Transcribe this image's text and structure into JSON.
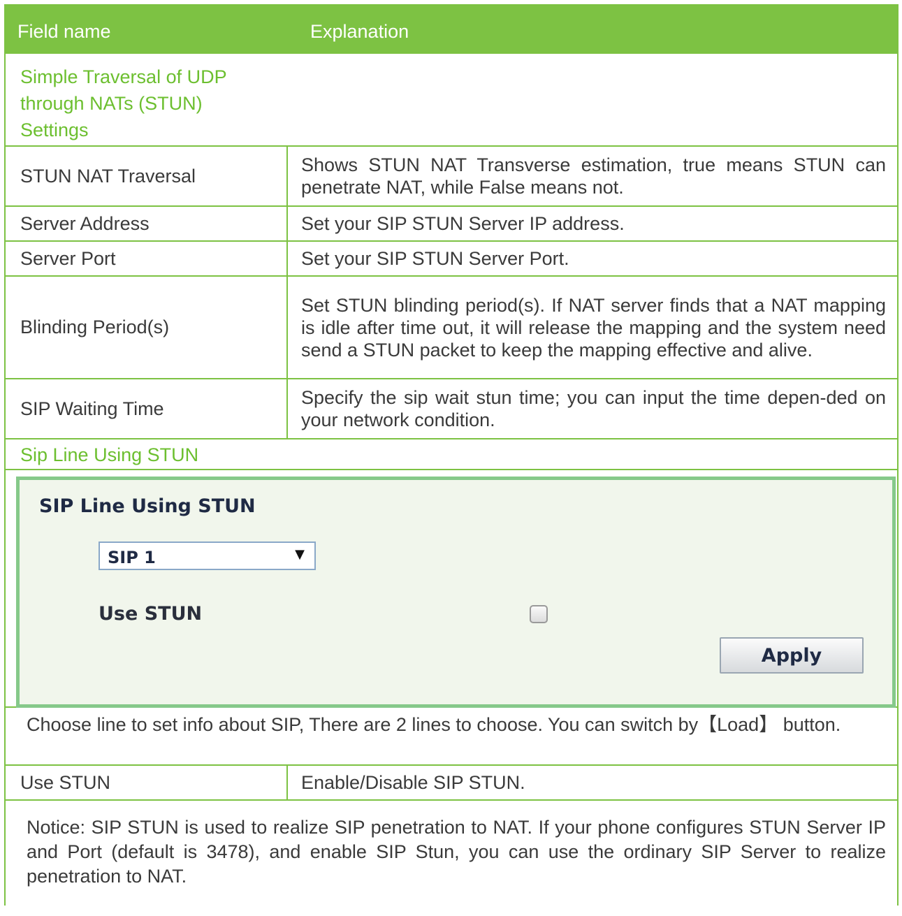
{
  "header": {
    "field_name": "Field name",
    "explanation": "Explanation"
  },
  "section_stun": {
    "title_lines": [
      "Simple Traversal of UDP",
      "through NATs (STUN)",
      "Settings"
    ]
  },
  "rows": [
    {
      "name": "STUN NAT Traversal",
      "desc": "Shows STUN NAT Transverse estimation, true means STUN can penetrate NAT, while False means not."
    },
    {
      "name": "Server Address",
      "desc": "Set your SIP STUN Server IP address."
    },
    {
      "name": "Server Port",
      "desc": "Set your SIP STUN Server Port."
    },
    {
      "name": "Blinding Period(s)",
      "desc": "Set STUN blinding period(s). If NAT server finds that a NAT mapping is idle after time out, it will release the mapping and the system need send a STUN packet to keep the mapping effective and alive."
    },
    {
      "name": "SIP Waiting Time",
      "desc": "Specify the sip wait stun time; you can input the time depen-ded on your network condition."
    }
  ],
  "section_sip_line": {
    "title": "Sip Line Using STUN"
  },
  "panel": {
    "title": "SIP Line Using STUN",
    "select_value": "SIP 1",
    "use_stun_label": "Use STUN",
    "use_stun_checked": false,
    "apply_label": "Apply"
  },
  "choose_text": "Choose line to set info about SIP, There are 2 lines to choose. You can switch by【Load】 button.",
  "use_stun_row": {
    "name": "Use STUN",
    "desc": "Enable/Disable SIP STUN."
  },
  "notice": "Notice: SIP STUN is used to realize SIP penetration to NAT. If your phone configures STUN Server IP and Port (default is 3478), and enable SIP Stun, you can use the ordinary SIP Server to realize penetration to NAT.",
  "colors": {
    "accent_green": "#7dc243",
    "section_text_green": "#6cbf2f",
    "panel_border": "#86c98a",
    "panel_background": "#f1f6ec"
  }
}
